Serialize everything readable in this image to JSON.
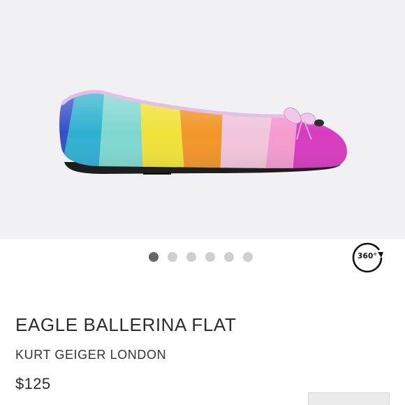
{
  "product": {
    "title": "EAGLE BALLERINA FLAT",
    "brand": "KURT GEIGER LONDON",
    "price": "$125"
  },
  "carousel": {
    "slide_count": 6,
    "active_index": 0
  },
  "view360": {
    "label": "360°"
  },
  "colors": {
    "hero_background": "#f1f0f3",
    "stripes": [
      "#3550c8",
      "#2fb0d0",
      "#7fd8d0",
      "#f0e23a",
      "#f2962a",
      "#f2c6dc",
      "#f59ad0",
      "#d83bc0"
    ],
    "dot_active": "#666666",
    "dot_inactive": "#cfcfcf"
  }
}
